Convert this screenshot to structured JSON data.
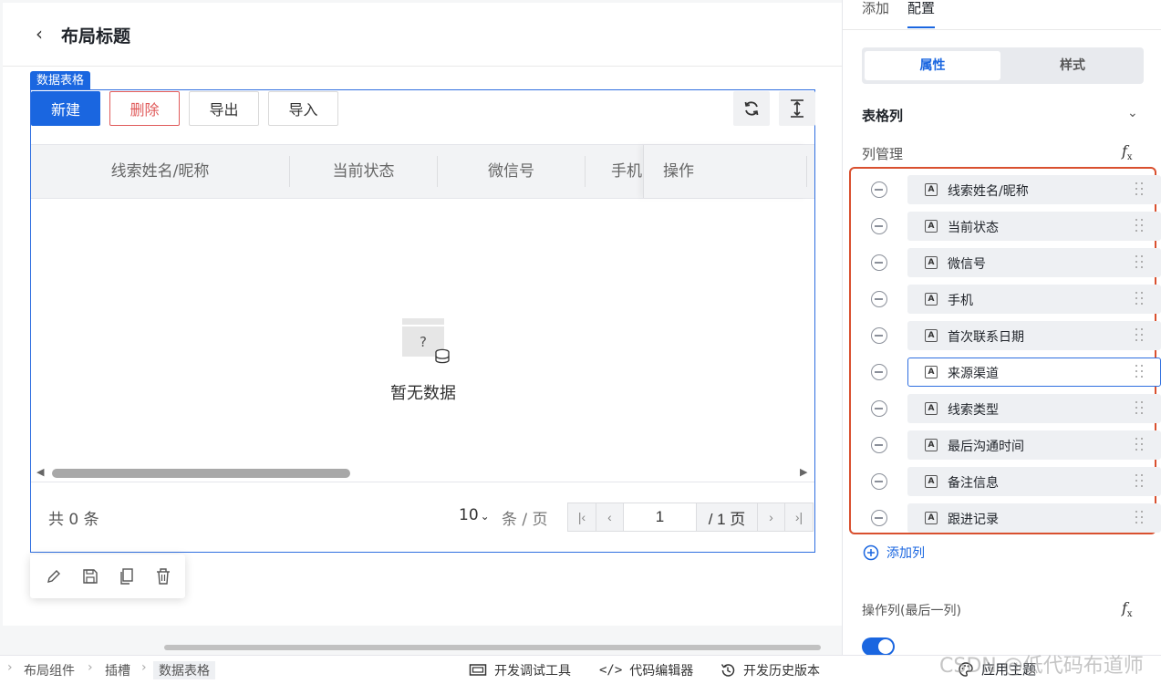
{
  "page": {
    "title": "布局标题"
  },
  "component_tag": "数据表格",
  "toolbar": {
    "new_label": "新建",
    "delete_label": "删除",
    "export_label": "导出",
    "import_label": "导入"
  },
  "table": {
    "columns": [
      "线索姓名/昵称",
      "当前状态",
      "微信号",
      "手机"
    ],
    "ops_column": "操作",
    "empty_text": "暂无数据"
  },
  "pagination": {
    "total_text": "共 0 条",
    "page_size": "10",
    "per_page_text": "条 / 页",
    "current_page": "1",
    "total_pages_text": "/ 1 页"
  },
  "statusbar": {
    "breadcrumbs": [
      "布局组件",
      "插槽",
      "数据表格"
    ],
    "dev_tools": "开发调试工具",
    "code_editor": "代码编辑器",
    "history": "开发历史版本"
  },
  "panel": {
    "tabs": [
      "添加",
      "配置"
    ],
    "segments": [
      "属性",
      "样式"
    ],
    "section_title": "表格列",
    "col_mgmt_label": "列管理",
    "fx": "fx",
    "columns": [
      {
        "label": "线索姓名/昵称",
        "selected": false
      },
      {
        "label": "当前状态",
        "selected": false
      },
      {
        "label": "微信号",
        "selected": false
      },
      {
        "label": "手机",
        "selected": false
      },
      {
        "label": "首次联系日期",
        "selected": false
      },
      {
        "label": "来源渠道",
        "selected": true
      },
      {
        "label": "线索类型",
        "selected": false
      },
      {
        "label": "最后沟通时间",
        "selected": false
      },
      {
        "label": "备注信息",
        "selected": false
      },
      {
        "label": "跟进记录",
        "selected": false
      }
    ],
    "column_type_glyph": "A",
    "add_column": "添加列",
    "ops_column_title": "操作列(最后一列)",
    "ops_column_enabled": true,
    "apply_theme": "应用主题"
  },
  "watermark": "CSDN @低代码布道师",
  "colors": {
    "accent": "#1a66e0",
    "danger": "#e05a5a",
    "highlight_box": "#d9502f"
  }
}
